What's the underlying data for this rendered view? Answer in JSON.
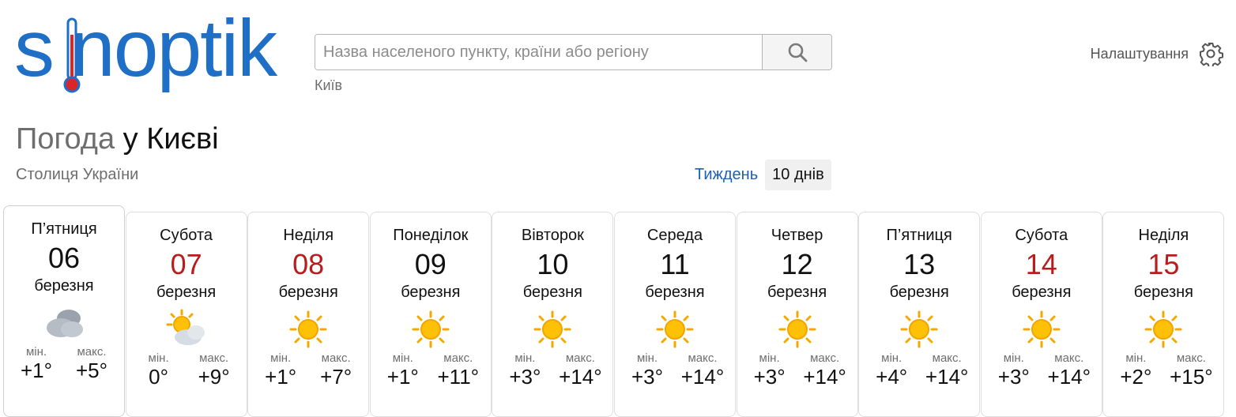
{
  "logo": {
    "text": "sinoptik"
  },
  "search": {
    "placeholder": "Назва населеного пункту, країни або регіону",
    "recent_city": "Київ"
  },
  "settings": {
    "label": "Налаштування",
    "icon": "gear-icon"
  },
  "title": {
    "part1": "Погода",
    "part2": "у Києві"
  },
  "subtitle": "Столиця України",
  "tabs": {
    "week": "Тиждень",
    "ten_days": "10 днів",
    "active": "10 днів"
  },
  "colors": {
    "brand": "#1f6fc6",
    "weekend": "#b81c1c",
    "link": "#1f5fb3"
  },
  "days": [
    {
      "name": "П’ятниця",
      "date": "06",
      "month": "березня",
      "weekend": false,
      "icon": "cloudy-icon",
      "min_label": "мін.",
      "max_label": "макс.",
      "min": "+1°",
      "max": "+5°"
    },
    {
      "name": "Субота",
      "date": "07",
      "month": "березня",
      "weekend": true,
      "icon": "partly-cloudy-icon",
      "min_label": "мін.",
      "max_label": "макс.",
      "min": "0°",
      "max": "+9°"
    },
    {
      "name": "Неділя",
      "date": "08",
      "month": "березня",
      "weekend": true,
      "icon": "sun-icon",
      "min_label": "мін.",
      "max_label": "макс.",
      "min": "+1°",
      "max": "+7°"
    },
    {
      "name": "Понеділок",
      "date": "09",
      "month": "березня",
      "weekend": false,
      "icon": "sun-icon",
      "min_label": "мін.",
      "max_label": "макс.",
      "min": "+1°",
      "max": "+11°"
    },
    {
      "name": "Вівторок",
      "date": "10",
      "month": "березня",
      "weekend": false,
      "icon": "sun-icon",
      "min_label": "мін.",
      "max_label": "макс.",
      "min": "+3°",
      "max": "+14°"
    },
    {
      "name": "Середа",
      "date": "11",
      "month": "березня",
      "weekend": false,
      "icon": "sun-icon",
      "min_label": "мін.",
      "max_label": "макс.",
      "min": "+3°",
      "max": "+14°"
    },
    {
      "name": "Четвер",
      "date": "12",
      "month": "березня",
      "weekend": false,
      "icon": "sun-icon",
      "min_label": "мін.",
      "max_label": "макс.",
      "min": "+3°",
      "max": "+14°"
    },
    {
      "name": "П’ятниця",
      "date": "13",
      "month": "березня",
      "weekend": false,
      "icon": "sun-icon",
      "min_label": "мін.",
      "max_label": "макс.",
      "min": "+4°",
      "max": "+14°"
    },
    {
      "name": "Субота",
      "date": "14",
      "month": "березня",
      "weekend": true,
      "icon": "sun-icon",
      "min_label": "мін.",
      "max_label": "макс.",
      "min": "+3°",
      "max": "+14°"
    },
    {
      "name": "Неділя",
      "date": "15",
      "month": "березня",
      "weekend": true,
      "icon": "sun-icon",
      "min_label": "мін.",
      "max_label": "макс.",
      "min": "+2°",
      "max": "+15°"
    }
  ]
}
